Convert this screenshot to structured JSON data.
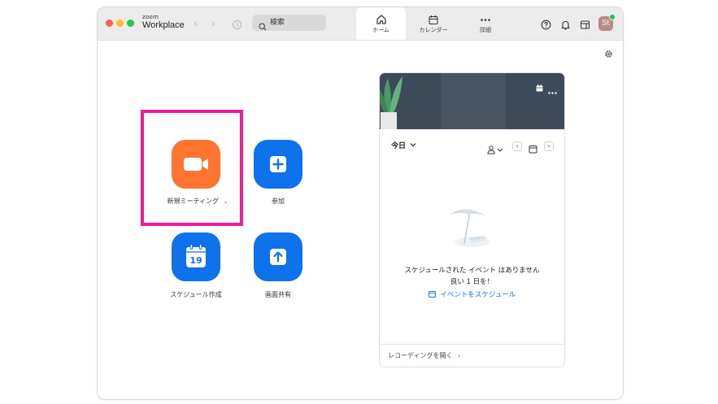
{
  "app": {
    "logo_small": "zoom",
    "logo_big": "Workplace",
    "avatar_initials": "St"
  },
  "titlebar": {
    "search_placeholder": "検索",
    "nav_back": "‹",
    "nav_forward": "›"
  },
  "tabs": [
    {
      "label": "ホーム",
      "icon": "home-icon",
      "active": true
    },
    {
      "label": "カレンダー",
      "icon": "calendar-icon",
      "active": false
    },
    {
      "label": "詳細",
      "icon": "more-icon",
      "active": false
    }
  ],
  "actions": {
    "new_meeting": "新規ミーティング",
    "new_meeting_chevron": "⌄",
    "join": "参加",
    "schedule": "スケジュール作成",
    "schedule_day": "19",
    "share_screen": "画面共有"
  },
  "calendar_panel": {
    "today_label": "今日",
    "empty_line1": "スケジュールされた イベント はありません",
    "empty_line2": "良い 1 日を！",
    "schedule_link": "イベントをスケジュール",
    "recordings_link": "レコーディングを開く",
    "recordings_chevron": "›"
  },
  "colors": {
    "orange": "#ff742e",
    "blue": "#0e72ed",
    "highlight": "#f21b9b",
    "banner": "#3d4a59"
  }
}
